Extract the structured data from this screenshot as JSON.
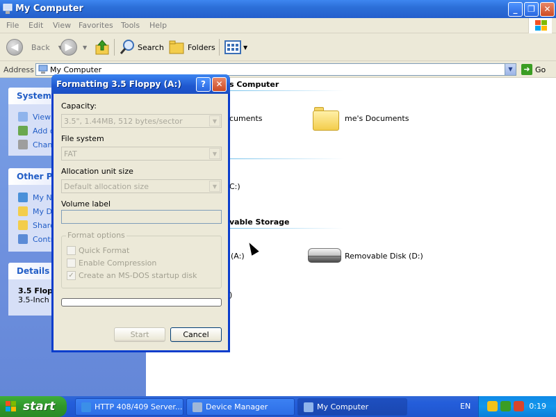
{
  "window": {
    "title": "My Computer",
    "buttons": {
      "minimize": "_",
      "maximize": "❐",
      "close": "✕"
    }
  },
  "menu": [
    "File",
    "Edit",
    "View",
    "Favorites",
    "Tools",
    "Help"
  ],
  "toolbar": {
    "back": "Back",
    "search": "Search",
    "folders": "Folders"
  },
  "address": {
    "label": "Address",
    "value": "My Computer",
    "go": "Go"
  },
  "left_panel": {
    "system_tasks": {
      "title": "System",
      "items": [
        "View",
        "Add o",
        "Chan"
      ]
    },
    "other_places": {
      "title": "Other Pla",
      "items": [
        "My Ne",
        "My Do",
        "Share",
        "Contr"
      ]
    },
    "details": {
      "title": "Details",
      "name": "3.5 Flopp",
      "desc": "3.5-Inch F"
    }
  },
  "content": {
    "group1_title": "s Computer",
    "item_docs_partial": "cuments",
    "item_docs_user": "me's Documents",
    "drive_c_partial": "C:)",
    "group2_title": "vable Storage",
    "floppy_partial": "(A:)",
    "removable": "Removable Disk (D:)",
    "extra_partial": ")"
  },
  "dialog": {
    "title": "Formatting 3.5 Floppy (A:)",
    "help": "?",
    "close": "✕",
    "capacity_label": "Capacity:",
    "capacity_value": "3.5\", 1.44MB, 512 bytes/sector",
    "filesystem_label": "File system",
    "filesystem_value": "FAT",
    "allocation_label": "Allocation unit size",
    "allocation_value": "Default allocation size",
    "volume_label": "Volume label",
    "volume_value": "",
    "format_options_label": "Format options",
    "quick_format": "Quick Format",
    "quick_format_checked": false,
    "enable_compression": "Enable Compression",
    "enable_compression_checked": false,
    "msdos_startup": "Create an MS-DOS startup disk",
    "msdos_startup_checked": true,
    "progress": 0,
    "start_button": "Start",
    "cancel_button": "Cancel"
  },
  "taskbar": {
    "start": "start",
    "buttons": [
      "HTTP 408/409 Server...",
      "Device Manager",
      "My Computer"
    ],
    "lang": "EN",
    "clock": "0:19"
  },
  "colors": {
    "titlebar": "#245fcc",
    "taskpane": "#6d8fdd",
    "start_green": "#2f962a",
    "dialog_border": "#0a3dcc"
  }
}
